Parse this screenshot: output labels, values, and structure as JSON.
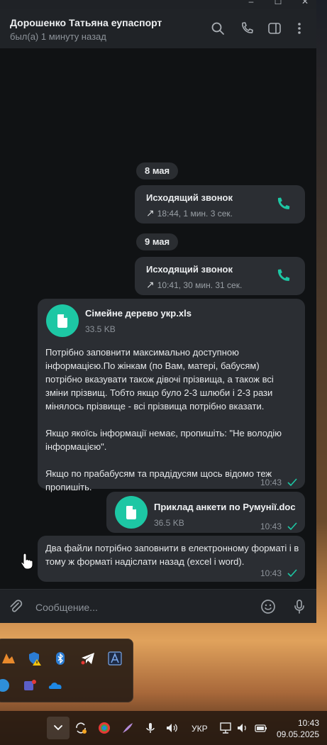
{
  "window": {
    "controls": [
      "–",
      "☐",
      "✕"
    ]
  },
  "header": {
    "contact_name": "Дорошенко Татьяна еупаспорт",
    "status": "был(а) 1 минуту назад",
    "icons": [
      "search-icon",
      "phone-icon",
      "sidebar-toggle-icon",
      "more-vertical-icon"
    ]
  },
  "messages": {
    "date1": "8 мая",
    "call1": {
      "title": "Исходящий звонок",
      "meta": "18:44, 1 мин. 3 сек."
    },
    "date2": "9 мая",
    "call2": {
      "title": "Исходящий звонок",
      "meta": "10:41, 30 мин. 31 сек."
    },
    "file1": {
      "name": "Сімейне дерево укр.xls",
      "size": "33.5 KB",
      "text": "Потрібно заповнити максимально доступною інформацією.По жінкам (по Вам, матері, бабусям) потрібно вказувати також дівочі прізвища, а також всі зміни прізвищ. Тобто якщо було 2-3 шлюби і 2-3 рази мінялось прізвище - всі прізвища потрібно вказати.\n\nЯкщо якоїсь інформації немає, пропишіть: \"Не володію інформацією\".\n\nЯкщо по прабабусям та прадідусям щось відомо теж пропишіть.",
      "time": "10:43"
    },
    "file2": {
      "name": "Приклад анкети по Румунії.doc",
      "size": "36.5 KB",
      "time": "10:43"
    },
    "text3": {
      "text": "Два файли потрібно заповнити в електронному форматі і в тому ж форматі надіслати назад (excel і word).",
      "time": "10:43"
    }
  },
  "composer": {
    "placeholder": "Сообщение..."
  },
  "taskbar": {
    "language": "УКР",
    "time": "10:43",
    "date": "09.05.2025"
  },
  "colors": {
    "accent": "#1dc7a4",
    "bubble": "#2b2e33",
    "background": "#101214"
  }
}
